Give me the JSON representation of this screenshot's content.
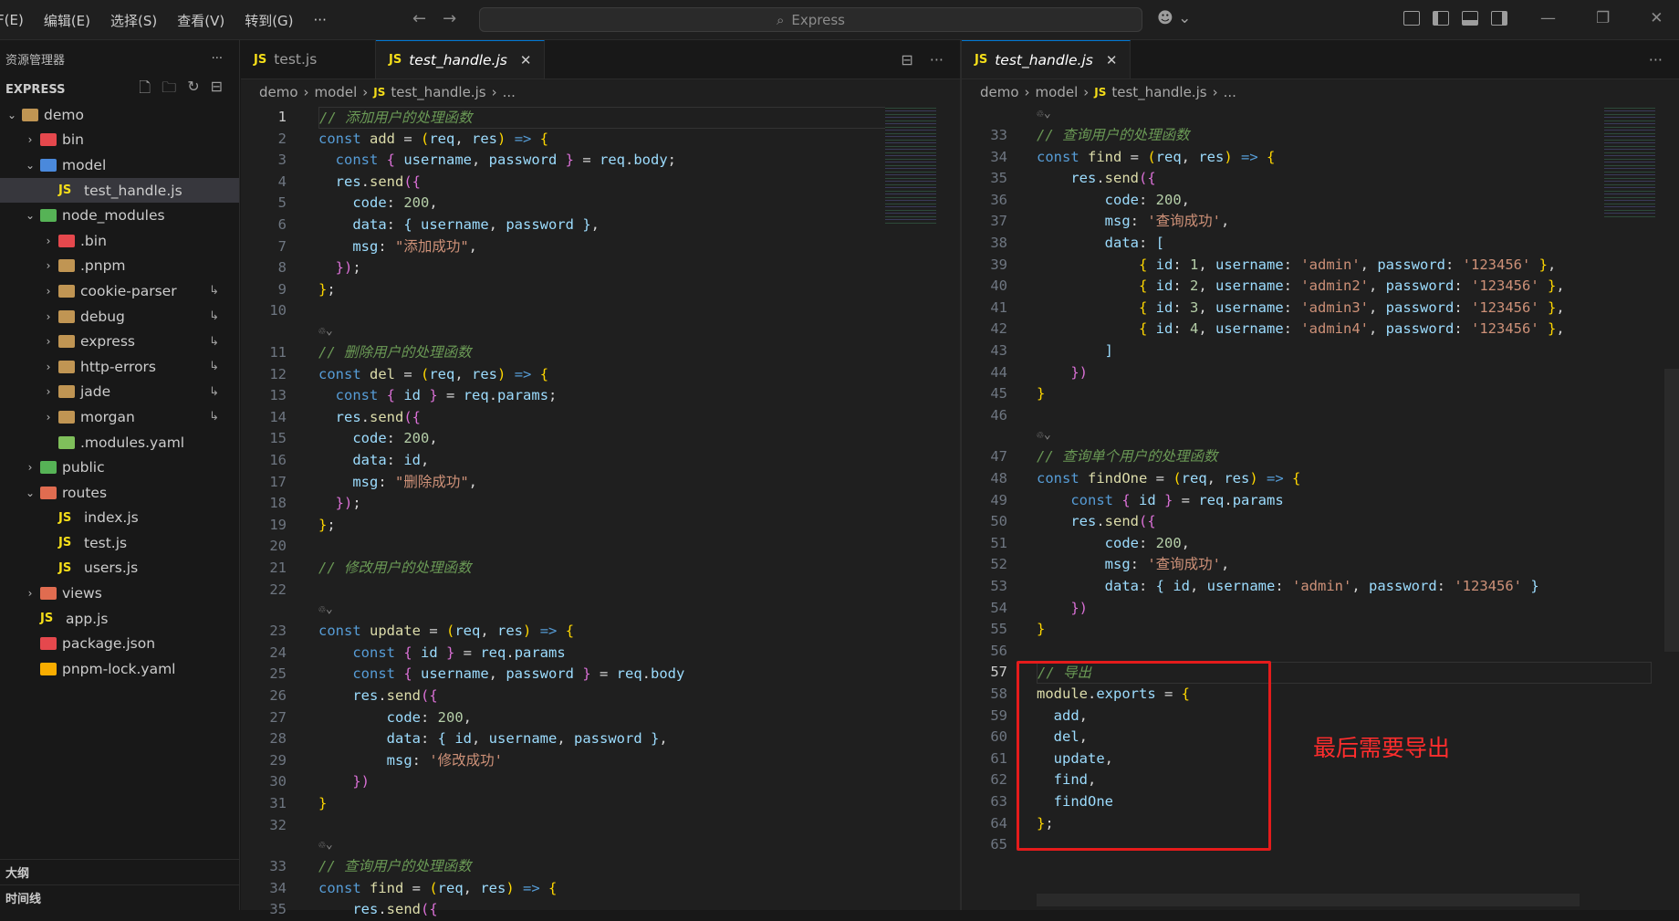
{
  "menu": {
    "items": [
      "F(E)",
      "编辑(E)",
      "选择(S)",
      "查看(V)",
      "转到(G)",
      "···"
    ]
  },
  "search": {
    "text": "Express"
  },
  "sidebar": {
    "title": "资源管理器",
    "section": "EXPRESS",
    "items": [
      {
        "label": "demo",
        "depth": 0,
        "kind": "folder-open"
      },
      {
        "label": "bin",
        "depth": 1,
        "kind": "folder"
      },
      {
        "label": "model",
        "depth": 1,
        "kind": "folder-open"
      },
      {
        "label": "test_handle.js",
        "depth": 2,
        "kind": "js",
        "selected": true
      },
      {
        "label": "node_modules",
        "depth": 1,
        "kind": "folder-open"
      },
      {
        "label": ".bin",
        "depth": 2,
        "kind": "folder"
      },
      {
        "label": ".pnpm",
        "depth": 2,
        "kind": "folder"
      },
      {
        "label": "cookie-parser",
        "depth": 2,
        "kind": "folder",
        "link": true
      },
      {
        "label": "debug",
        "depth": 2,
        "kind": "folder",
        "link": true
      },
      {
        "label": "express",
        "depth": 2,
        "kind": "folder",
        "link": true
      },
      {
        "label": "http-errors",
        "depth": 2,
        "kind": "folder",
        "link": true
      },
      {
        "label": "jade",
        "depth": 2,
        "kind": "folder",
        "link": true
      },
      {
        "label": "morgan",
        "depth": 2,
        "kind": "folder",
        "link": true
      },
      {
        "label": ".modules.yaml",
        "depth": 2,
        "kind": "file"
      },
      {
        "label": "public",
        "depth": 1,
        "kind": "folder"
      },
      {
        "label": "routes",
        "depth": 1,
        "kind": "folder-open"
      },
      {
        "label": "index.js",
        "depth": 2,
        "kind": "js"
      },
      {
        "label": "test.js",
        "depth": 2,
        "kind": "js"
      },
      {
        "label": "users.js",
        "depth": 2,
        "kind": "js"
      },
      {
        "label": "views",
        "depth": 1,
        "kind": "folder"
      },
      {
        "label": "app.js",
        "depth": 1,
        "kind": "js"
      },
      {
        "label": "package.json",
        "depth": 1,
        "kind": "file"
      },
      {
        "label": "pnpm-lock.yaml",
        "depth": 1,
        "kind": "file"
      }
    ],
    "outline": "大纲",
    "timeline": "时间线"
  },
  "left_editor": {
    "tabs": [
      {
        "label": "test.js",
        "active": false
      },
      {
        "label": "test_handle.js",
        "active": true
      }
    ],
    "breadcrumb": [
      "demo",
      "model",
      "test_handle.js",
      "..."
    ]
  },
  "right_editor": {
    "tabs": [
      {
        "label": "test_handle.js",
        "active": true
      }
    ],
    "breadcrumb": [
      "demo",
      "model",
      "test_handle.js",
      "..."
    ]
  },
  "annotation": {
    "text": "最后需要导出"
  }
}
